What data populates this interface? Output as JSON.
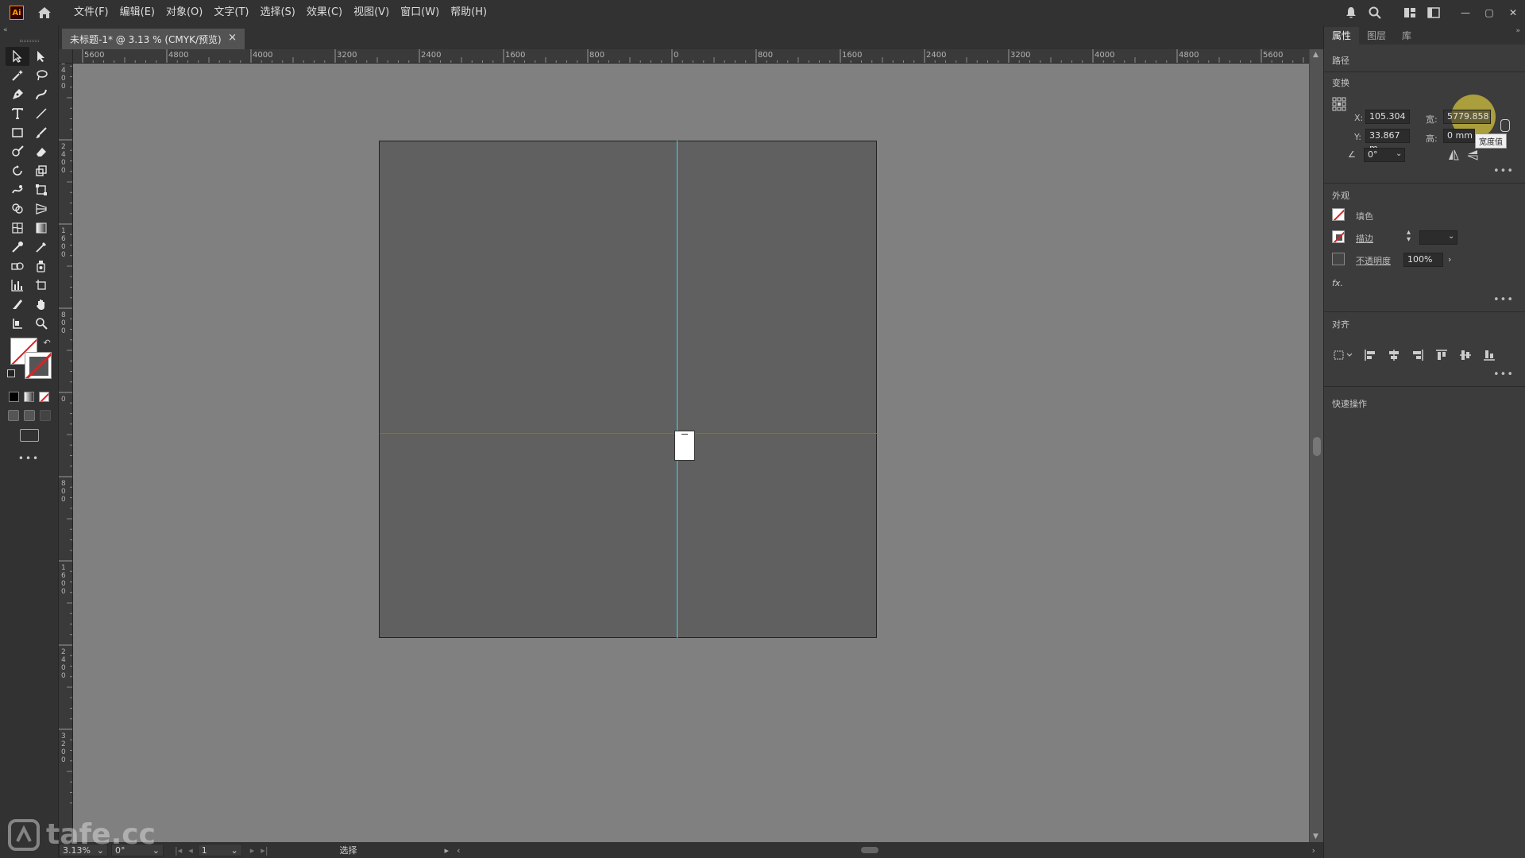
{
  "app": {
    "logo": "Ai",
    "accent": "#ff9a00"
  },
  "menu": [
    "文件(F)",
    "编辑(E)",
    "对象(O)",
    "文字(T)",
    "选择(S)",
    "效果(C)",
    "视图(V)",
    "窗口(W)",
    "帮助(H)"
  ],
  "document": {
    "tab_title": "未标题-1* @ 3.13 % (CMYK/预览)",
    "close": "×"
  },
  "ruler_h": [
    "5600",
    "4800",
    "4000",
    "3200",
    "2400",
    "1600",
    "800",
    "0",
    "800",
    "1600",
    "2400",
    "3200",
    "4000",
    "4800",
    "5600"
  ],
  "ruler_v": [
    "2400",
    "2400",
    "1600",
    "800",
    "0",
    "800",
    "1600",
    "2400",
    "3200"
  ],
  "status": {
    "zoom": "3.13%",
    "rotation": "0°",
    "artboard": "1",
    "tool": "选择"
  },
  "panel": {
    "tabs": [
      "属性",
      "图层",
      "库"
    ],
    "object_type": "路径",
    "transform": {
      "title": "变换",
      "x_label": "X:",
      "x": "105.304",
      "y_label": "Y:",
      "y": "33.867 m",
      "w_label": "宽:",
      "w": "5779.858",
      "h_label": "高:",
      "h": "0 mm",
      "angle": "0°",
      "tooltip": "宽度值"
    },
    "appearance": {
      "title": "外观",
      "fill": "填色",
      "stroke": "描边",
      "opacity_label": "不透明度",
      "opacity": "100%",
      "fx": "fx."
    },
    "align": {
      "title": "对齐"
    },
    "quick_actions": {
      "title": "快速操作"
    }
  },
  "watermark": "tafe.cc",
  "colors": {
    "guide_vertical": "#2fe0f0",
    "guide_horizontal": "#4a6fd8",
    "canvas": "#808080",
    "artboard": "#606060"
  }
}
